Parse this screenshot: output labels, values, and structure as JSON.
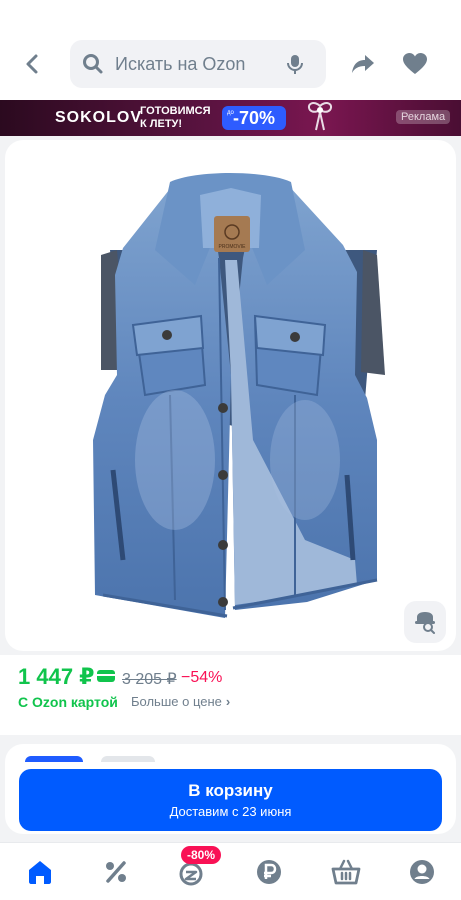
{
  "header": {
    "search_placeholder": "Искать на Ozon"
  },
  "banner": {
    "brand": "SOKOLOV",
    "promo_line1": "ГОТОВИМСЯ",
    "promo_line2": "К ЛЕТУ!",
    "sale_prefix": "до",
    "sale": "-70%",
    "ad_label": "Реклама"
  },
  "product": {
    "image_alt": "Джинсовый жилет",
    "label_text": "PROMOVIE"
  },
  "price": {
    "current": "1 447 ₽",
    "old": "3 205 ₽",
    "discount": "−54%",
    "ozon_card": "С Ozon картой",
    "more": "Больше о цене",
    "more_chevron": "›"
  },
  "cart_button": {
    "main": "В корзину",
    "sub": "Доставим с 23 июня"
  },
  "bottom_nav": {
    "fresh_badge": "-80%"
  },
  "colors": {
    "accent": "#005bff",
    "price_green": "#10c44c",
    "discount_red": "#f91155"
  },
  "icons": [
    "back-icon",
    "search-icon",
    "mic-icon",
    "share-icon",
    "heart-icon",
    "visual-search-icon",
    "home-icon",
    "percent-icon",
    "fresh-icon",
    "ruble-icon",
    "cart-icon",
    "profile-icon"
  ]
}
